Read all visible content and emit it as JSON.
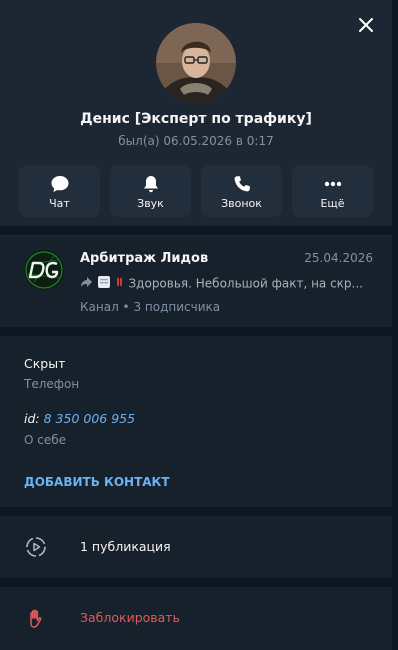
{
  "header": {
    "name": "Денис [Эксперт по трафику]",
    "status": "был(а) 06.05.2026 в 0:17"
  },
  "actions": [
    {
      "label": "Чат",
      "icon": "chat-icon"
    },
    {
      "label": "Звук",
      "icon": "bell-icon"
    },
    {
      "label": "Звонок",
      "icon": "phone-icon"
    },
    {
      "label": "Ещё",
      "icon": "more-icon"
    }
  ],
  "channel": {
    "title": "Арбитраж Лидов",
    "date": "25.04.2026",
    "message": "Здоровья. Небольшой факт, на скр...",
    "subtitle": "Канал • 3 подписчика"
  },
  "info": {
    "phone_value": "Скрыт",
    "phone_label": "Телефон",
    "id_prefix": "id:",
    "id_value": "8 350 006 955",
    "about_label": "О себе",
    "add_contact": "ДОБАВИТЬ КОНТАКТ"
  },
  "publications": {
    "label": "1 публикация"
  },
  "block": {
    "label": "Заблокировать"
  },
  "colors": {
    "accent": "#6ab2f2",
    "danger": "#e05a5a",
    "muted": "#7f91a4",
    "background": "#17212b"
  }
}
